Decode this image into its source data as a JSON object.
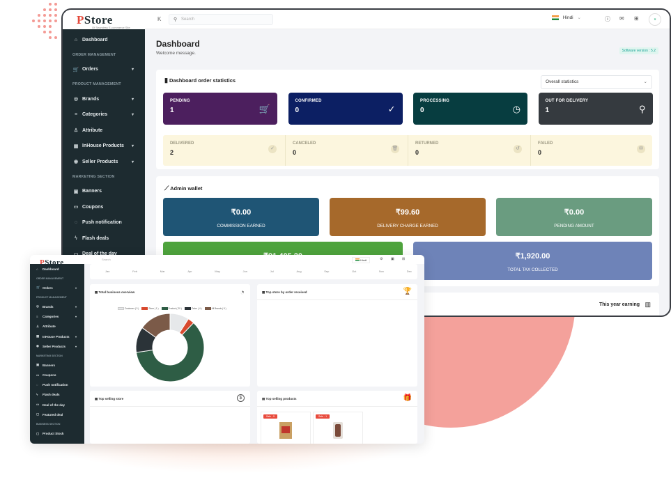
{
  "app": {
    "logo": "Store",
    "logo_p": "P",
    "logo_i": "i",
    "tagline": "Of Seamless E-commerce Site"
  },
  "topbar": {
    "search_placeholder": "Search",
    "language": "Hindi",
    "avatar_initial": "u"
  },
  "sidebar": {
    "items": [
      {
        "type": "item",
        "label": "Dashboard",
        "icon": "home-icon",
        "glyph": "⌂",
        "arrow": false
      },
      {
        "type": "section",
        "label": "ORDER MANAGEMENT"
      },
      {
        "type": "item",
        "label": "Orders",
        "icon": "cart-icon",
        "glyph": "🛒",
        "arrow": true
      },
      {
        "type": "section",
        "label": "PRODUCT MANAGEMENT"
      },
      {
        "type": "item",
        "label": "Brands",
        "icon": "apple-icon",
        "glyph": "◎",
        "arrow": true
      },
      {
        "type": "item",
        "label": "Categories",
        "icon": "filter-icon",
        "glyph": "≡",
        "arrow": true
      },
      {
        "type": "item",
        "label": "Attribute",
        "icon": "user-icon",
        "glyph": "♙",
        "arrow": false
      },
      {
        "type": "item",
        "label": "InHouse Products",
        "icon": "shop-icon",
        "glyph": "▦",
        "arrow": true
      },
      {
        "type": "item",
        "label": "Seller Products",
        "icon": "seller-icon",
        "glyph": "◉",
        "arrow": true
      },
      {
        "type": "section",
        "label": "MARKETING SECTION"
      },
      {
        "type": "item",
        "label": "Banners",
        "icon": "image-icon",
        "glyph": "▣",
        "arrow": false
      },
      {
        "type": "item",
        "label": "Coupons",
        "icon": "coupon-icon",
        "glyph": "▭",
        "arrow": false
      },
      {
        "type": "item",
        "label": "Push notification",
        "icon": "bell-icon",
        "glyph": "◌",
        "arrow": false
      },
      {
        "type": "item",
        "label": "Flash deals",
        "icon": "flash-icon",
        "glyph": "ϟ",
        "arrow": false
      },
      {
        "type": "item",
        "label": "Deal of the day",
        "icon": "deal-icon",
        "glyph": "▭",
        "arrow": false
      },
      {
        "type": "item",
        "label": "Featured deal",
        "icon": "featured-icon",
        "glyph": "▢",
        "arrow": false
      },
      {
        "type": "section",
        "label": "BUSINESS SECTION"
      },
      {
        "type": "item",
        "label": "Product Stock",
        "icon": "stock-icon",
        "glyph": "▢",
        "arrow": false
      }
    ]
  },
  "page": {
    "title": "Dashboard",
    "subtitle": "Welcome message.",
    "version": "Software version : 5.2"
  },
  "order_stats": {
    "title": "Dashboard order statistics",
    "filter": "Overall statistics",
    "primary": [
      {
        "label": "PENDING",
        "value": "1",
        "color": "#4c1f5e",
        "icon": "cart-icon",
        "glyph": "🛒"
      },
      {
        "label": "CONFIRMED",
        "value": "0",
        "color": "#0c1f63",
        "icon": "check-circle-icon",
        "glyph": "✓"
      },
      {
        "label": "PROCESSING",
        "value": "0",
        "color": "#073d40",
        "icon": "clock-icon",
        "glyph": "◷"
      },
      {
        "label": "OUT FOR DELIVERY",
        "value": "1",
        "color": "#353a3f",
        "icon": "bike-icon",
        "glyph": "⚲"
      }
    ],
    "secondary": [
      {
        "label": "DELIVERED",
        "value": "2",
        "icon": "check-icon",
        "glyph": "✓"
      },
      {
        "label": "CANCELED",
        "value": "0",
        "icon": "trash-icon",
        "glyph": "🗑"
      },
      {
        "label": "RETURNED",
        "value": "0",
        "icon": "return-icon",
        "glyph": "↺"
      },
      {
        "label": "FAILED",
        "value": "0",
        "icon": "message-icon",
        "glyph": "✉"
      }
    ]
  },
  "wallet": {
    "title": "Admin wallet",
    "cards": [
      {
        "value": "₹0.00",
        "label": "COMMISSION EARNED",
        "color": "#1f5575"
      },
      {
        "value": "₹99.60",
        "label": "DELIVERY CHARGE EARNED",
        "color": "#a6692b"
      },
      {
        "value": "₹0.00",
        "label": "PENDING AMOUNT",
        "color": "#6a9c80"
      },
      {
        "value": "₹91,405.20",
        "label": "",
        "color": "#4ea33d"
      },
      {
        "value": "₹1,920.00",
        "label": "TOTAL TAX COLLECTED",
        "color": "#6e83b8"
      }
    ],
    "year_earning": "This year earning"
  },
  "mini": {
    "months": [
      "Jan",
      "Feb",
      "Mar",
      "Apr",
      "May",
      "Jun",
      "Jul",
      "Aug",
      "Sep",
      "Oct",
      "Nov",
      "Dec"
    ],
    "business_title": "Total business overview",
    "store_title": "Top store by order received",
    "selling_store_title": "Top selling store",
    "selling_products_title": "Top selling products",
    "sale_tag": "Sale - 5",
    "sale_tag2": "Sale - 1"
  },
  "chart_data": {
    "type": "pie",
    "title": "Total business overview",
    "legend_placement": "top",
    "series": [
      {
        "name": "Customer ( 3 )",
        "value": 3,
        "color": "#e6e8ea"
      },
      {
        "name": "Store ( 1 )",
        "value": 1,
        "color": "#d8492e"
      },
      {
        "name": "Product ( 20 )",
        "value": 20,
        "color": "#2e5d45"
      },
      {
        "name": "Order ( 4 )",
        "value": 4,
        "color": "#2b3338"
      },
      {
        "name": "All Brands ( 5 )",
        "value": 5,
        "color": "#7b5a48"
      }
    ]
  }
}
